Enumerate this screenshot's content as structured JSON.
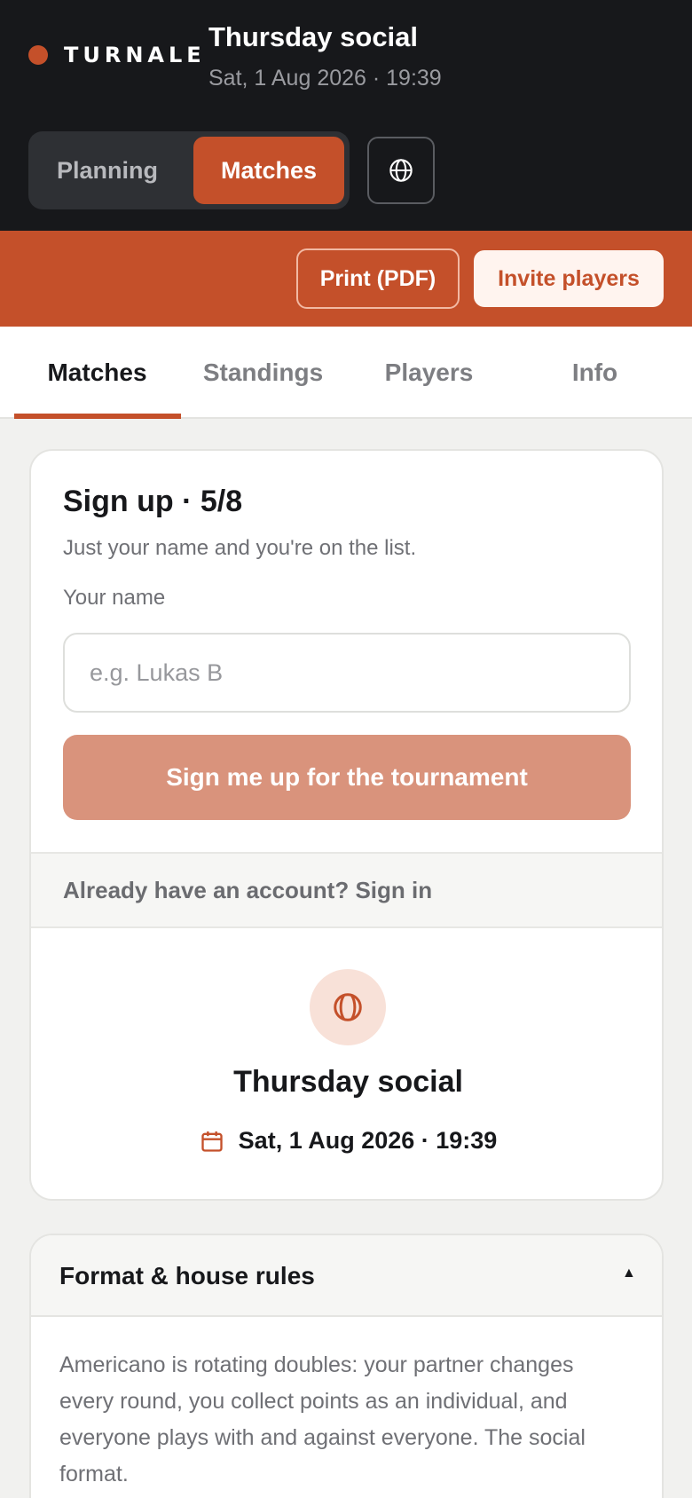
{
  "brand": {
    "name": "TURNALE",
    "dot_color": "#c4502a"
  },
  "event": {
    "title": "Thursday social",
    "datetime": "Sat, 1 Aug 2026 · 19:39"
  },
  "mode_switch": {
    "planning": "Planning",
    "matches": "Matches",
    "active": "Matches"
  },
  "language_button": {
    "icon": "globe-icon"
  },
  "actions": {
    "print": "Print (PDF)",
    "invite": "Invite players"
  },
  "tabs": {
    "items": [
      {
        "label": "Matches"
      },
      {
        "label": "Standings"
      },
      {
        "label": "Players"
      },
      {
        "label": "Info"
      }
    ],
    "active": "Matches"
  },
  "signup": {
    "title": "Sign up · 5/8",
    "subtitle": "Just your name and you're on the list.",
    "name_label": "Your name",
    "name_value": "",
    "name_placeholder": "e.g. Lukas B",
    "button": "Sign me up for the tournament",
    "signin_prompt": "Already have an account? Sign in"
  },
  "event_summary": {
    "icon": "padel-ball-icon",
    "name": "Thursday social",
    "date_icon": "calendar-icon",
    "datetime": "Sat, 1 Aug 2026 · 19:39"
  },
  "rules": {
    "title": "Format & house rules",
    "expanded": true,
    "caret": "▲",
    "text": "Americano is rotating doubles: your partner changes every round, you collect points as an individual, and everyone plays with and against everyone. The social format."
  },
  "colors": {
    "accent": "#c4502a",
    "header_bg": "#17181b",
    "page_bg": "#f1f1ef",
    "button_muted": "#d9937c"
  }
}
